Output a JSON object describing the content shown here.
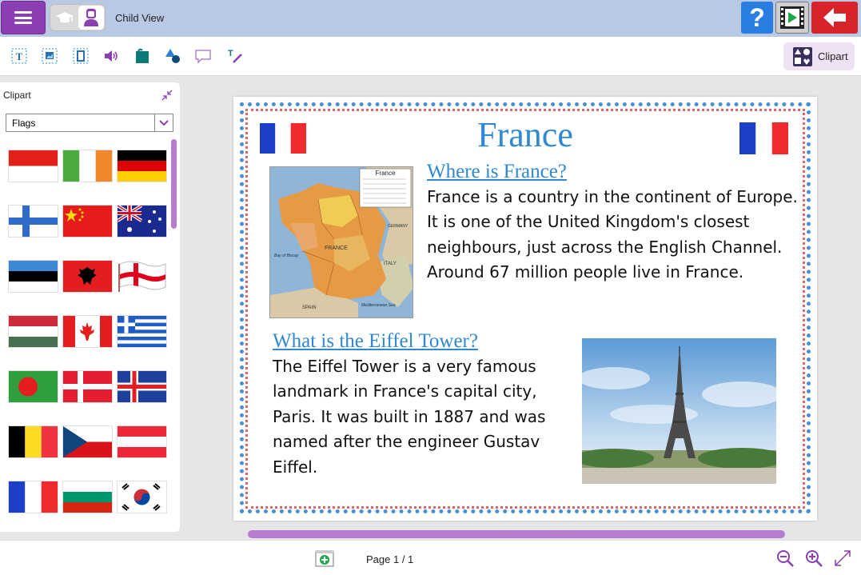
{
  "header": {
    "view_label": "Child View",
    "help_label": "?"
  },
  "toolbar": {
    "tools": [
      "text-tool-icon",
      "image-tool-icon",
      "resize-tool-icon",
      "sound-tool-icon",
      "fill-tool-icon",
      "shapes-tool-icon",
      "speech-bubble-icon",
      "text-style-icon"
    ],
    "clipart_label": "Clipart"
  },
  "sidebar": {
    "title": "Clipart",
    "category": "Flags",
    "flags": [
      "Indonesia",
      "Ireland",
      "Germany",
      "Finland",
      "China",
      "Australia",
      "Estonia",
      "Albania",
      "England",
      "Hungary",
      "Canada",
      "Greece",
      "Bangladesh",
      "Denmark",
      "Iceland",
      "Belgium",
      "Czech Republic",
      "Austria",
      "France",
      "Bulgaria",
      "South Korea"
    ]
  },
  "document": {
    "title": "France",
    "heading_1": "Where is France?",
    "paragraph_1": "France is a country in the continent of Europe. It is one of the United Kingdom's closest neighbours, just across the English Channel.",
    "paragraph_1b": "Around 67 million people live in France.",
    "heading_2": "What is the Eiffel Tower?",
    "paragraph_2": "The Eiffel Tower is a very famous landmark in France's capital city, Paris. It was built in 1887 and was named after the engineer Gustav Eiffel.",
    "map_labels": {
      "legend_title": "France",
      "france": "FRANCE",
      "germany": "GERMANY",
      "italy": "ITALY",
      "spain": "SPAIN",
      "bay": "Bay of Biscay",
      "med": "Mediterranean Sea"
    }
  },
  "footer": {
    "page_indicator": "Page 1 / 1"
  },
  "colors": {
    "accent_purple": "#8b3fb2",
    "header_bg": "#b9c9e4",
    "title_blue": "#2e88d2",
    "help_blue": "#2a7de1",
    "back_red": "#d8232a"
  }
}
